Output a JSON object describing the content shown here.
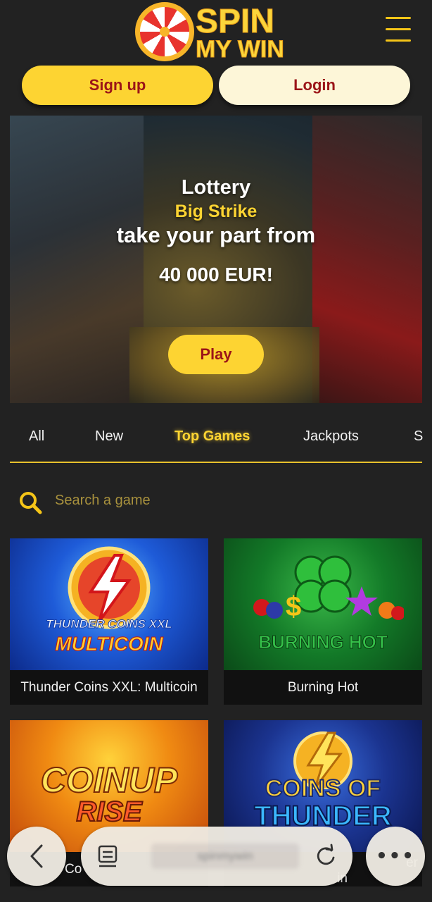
{
  "header": {
    "logo_line1": "SPIN",
    "logo_line2": "MY WIN",
    "brand_color": "#fdd432",
    "accent_color": "#9b1518"
  },
  "auth": {
    "signup_label": "Sign up",
    "login_label": "Login"
  },
  "banner": {
    "line1": "Lottery",
    "line2": "Big Strike",
    "line3": "take your part from",
    "line4": "40 000 EUR!",
    "play_label": "Play"
  },
  "tabs": [
    {
      "label": "All"
    },
    {
      "label": "New"
    },
    {
      "label": "Top Games",
      "active": true
    },
    {
      "label": "Jackpots"
    },
    {
      "label": "S"
    }
  ],
  "search": {
    "placeholder": "Search a game",
    "icon": "search-icon"
  },
  "games": [
    {
      "name": "Thunder Coins XXL: Multicoin",
      "thumb_line1": "THUNDER COINS XXL",
      "thumb_line2": "MULTICOIN"
    },
    {
      "name": "Burning Hot",
      "thumb_line1": "BURNING HOT"
    },
    {
      "name": "Co",
      "thumb_line1": "COINUP",
      "thumb_line2": "RISE"
    },
    {
      "name": "er",
      "name_line2": "in",
      "thumb_line1": "COINS OF",
      "thumb_line2": "THUNDER"
    }
  ],
  "browser": {
    "url_text": "spinmywin",
    "more_label": "•••"
  }
}
